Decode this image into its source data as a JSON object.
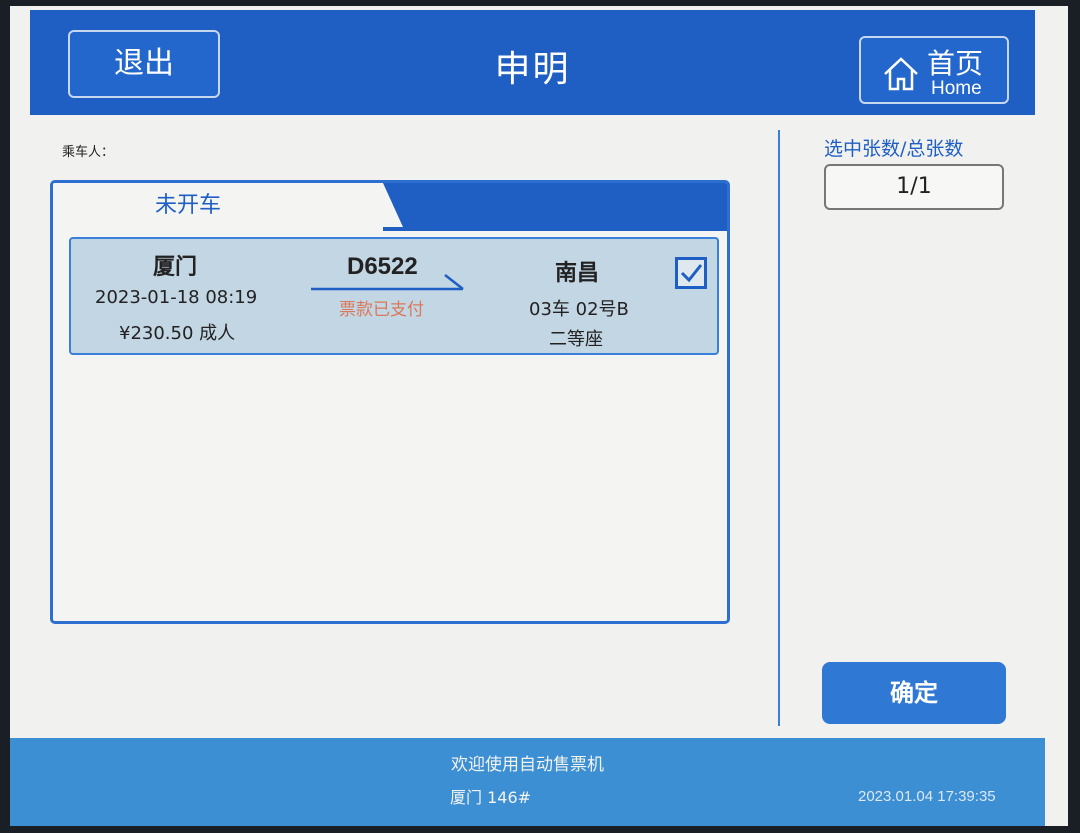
{
  "header": {
    "exit_label": "退出",
    "title": "申明",
    "home_label_zh": "首页",
    "home_label_en": "Home"
  },
  "passenger_label": "乘车人：",
  "tabs": [
    {
      "label": "未开车",
      "active": true
    },
    {
      "label": "",
      "active": false
    }
  ],
  "ticket": {
    "from_station": "厦门",
    "departure": "2023-01-18 08:19",
    "price": "¥230.50 成人",
    "train_no": "D6522",
    "status": "票款已支付",
    "to_station": "南昌",
    "seat": "03车 02号B",
    "seat_class": "二等座",
    "selected": true
  },
  "side": {
    "count_label": "选中张数/总张数",
    "count_value": "1/1",
    "confirm_label": "确定"
  },
  "footer": {
    "welcome": "欢迎使用自动售票机",
    "location": "厦门 146#",
    "datetime": "2023.01.04   17:39:35"
  },
  "colors": {
    "primary": "#1f5fc4",
    "footer": "#3c8fd3",
    "ticket_bg": "#c3d6e3",
    "status_paid": "#d9785a"
  }
}
